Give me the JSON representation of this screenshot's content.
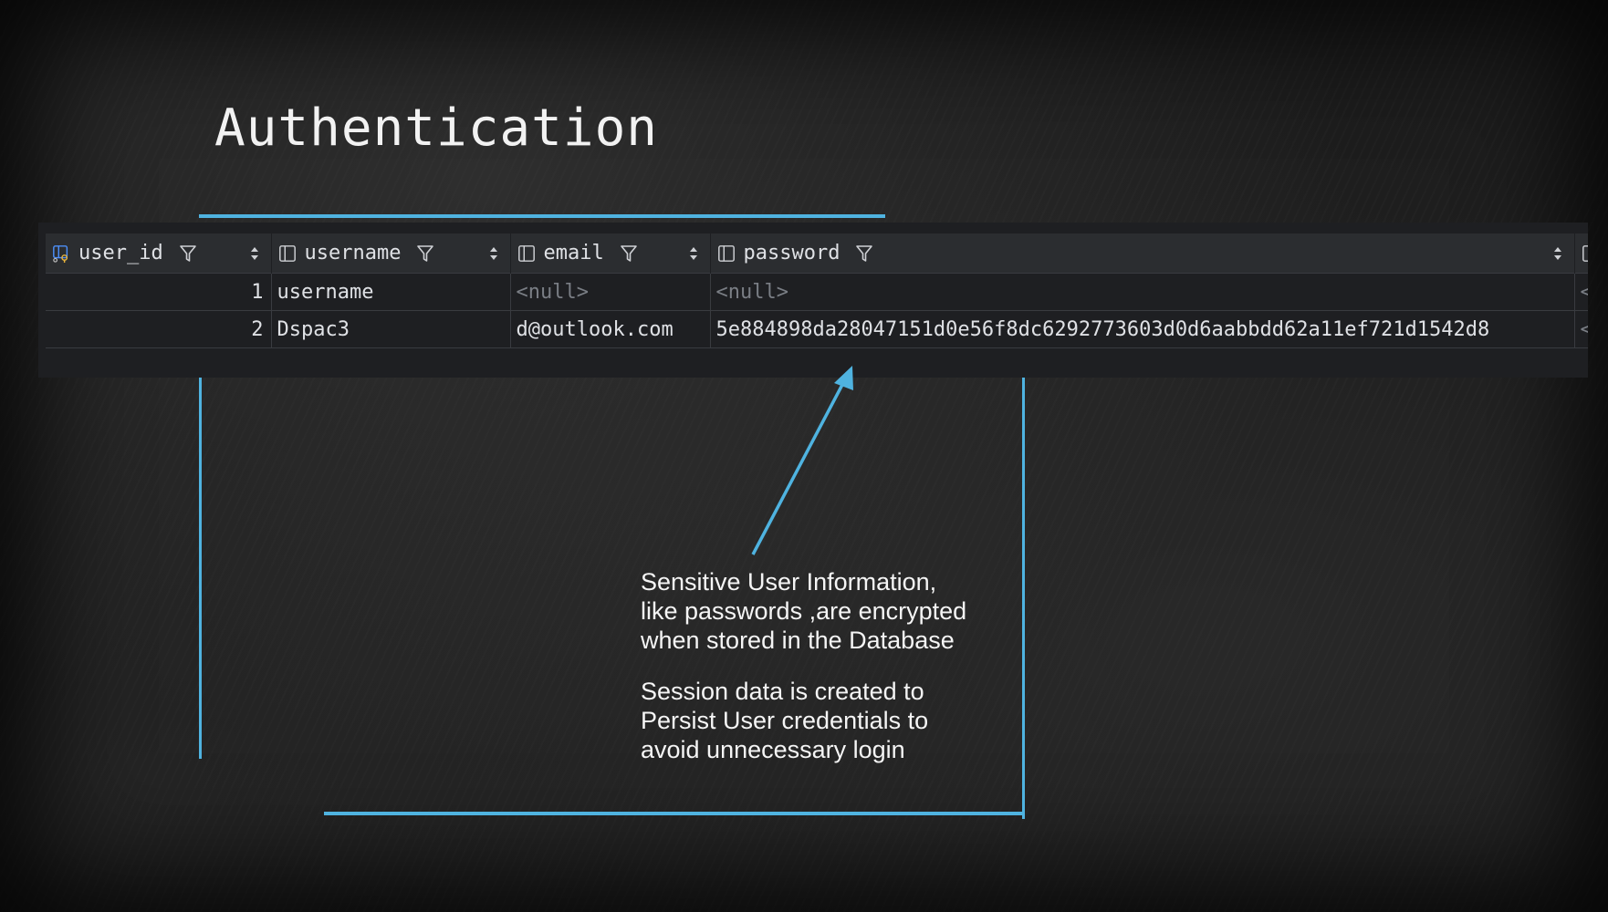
{
  "slide": {
    "title": "Authentication",
    "notes": [
      "Sensitive User Information, like passwords ,are encrypted when stored in the Database",
      "Session data is created to Persist User credentials to avoid unnecessary login"
    ]
  },
  "db_table": {
    "columns": [
      {
        "label": "user_id",
        "icon": "primary-key-column-icon"
      },
      {
        "label": "username",
        "icon": "column-icon"
      },
      {
        "label": "email",
        "icon": "column-icon"
      },
      {
        "label": "password",
        "icon": "column-icon"
      }
    ],
    "rows": [
      {
        "num": "1",
        "username": "username",
        "email": "<null>",
        "password": "<null>",
        "more": "<"
      },
      {
        "num": "2",
        "username": "Dspac3",
        "email": "d@outlook.com",
        "password": "5e884898da28047151d0e56f8dc6292773603d0d6aabbdd62a11ef721d1542d8",
        "more": "<"
      }
    ]
  },
  "colors": {
    "accent": "#4fb3e0",
    "panel_bg": "#1e1f22",
    "header_bg": "#2b2d30",
    "null_text": "#7a7e85"
  }
}
